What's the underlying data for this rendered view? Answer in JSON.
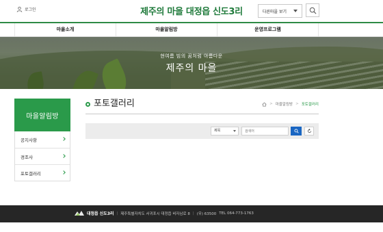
{
  "header": {
    "login_label": "로그인",
    "site_title": "제주의 마을 대정읍 신도3리",
    "village_select_label": "다른마을 보기",
    "search_icon": "search-icon"
  },
  "nav": {
    "items": [
      {
        "label": "마을소개"
      },
      {
        "label": "마을알림방"
      },
      {
        "label": "운영프로그램"
      }
    ]
  },
  "banner": {
    "subtitle": "현여름 빔의 꿈처럼 아름다운",
    "title": "제주의 마을"
  },
  "sidebar": {
    "title": "마을알림방",
    "items": [
      {
        "label": "공지사항"
      },
      {
        "label": "경조사"
      },
      {
        "label": "포토갤러리"
      }
    ]
  },
  "content": {
    "page_title": "포토갤러리",
    "breadcrumb": [
      "마을알림방",
      "포토갤러리"
    ]
  },
  "search": {
    "field_selected": "제목",
    "keyword_placeholder": "검색어",
    "submit_icon": "search-icon",
    "reset_icon": "refresh-icon"
  },
  "footer": {
    "logo_text": "대정읍 신도3리",
    "address": "제주특별자치도 서귀포시 대정읍 비자남로 8",
    "zipcode": "(우) 63500",
    "tel": "TEL 064-773-1763"
  },
  "colors": {
    "brand_green": "#2a9a4a",
    "title_green": "#1f7a3b",
    "search_blue": "#1a66c2",
    "footer_bg": "#262626"
  }
}
